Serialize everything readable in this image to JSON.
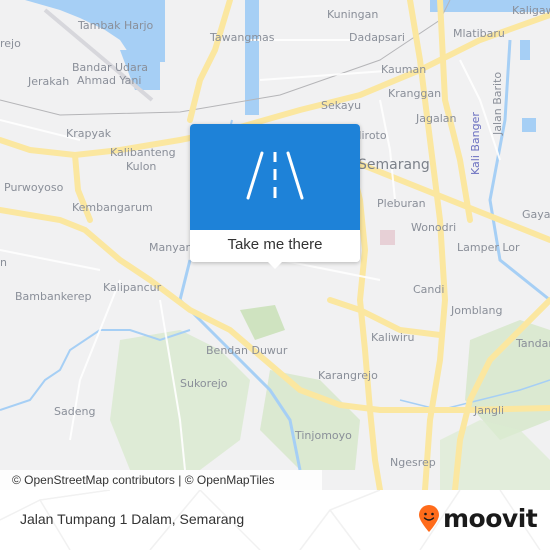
{
  "map": {
    "places": [
      {
        "name": "Tambak Harjo",
        "size": "normal"
      },
      {
        "name": "rejo",
        "size": "normal"
      },
      {
        "name": "Bandar Udara",
        "size": "normal"
      },
      {
        "name": "Ahmad Yani",
        "size": "normal"
      },
      {
        "name": "Jerakah",
        "size": "normal"
      },
      {
        "name": "Krapyak",
        "size": "normal"
      },
      {
        "name": "Kalibanteng",
        "size": "normal"
      },
      {
        "name": "Kulon",
        "size": "normal"
      },
      {
        "name": "Purwoyoso",
        "size": "normal"
      },
      {
        "name": "Kembangarum",
        "size": "normal"
      },
      {
        "name": "Manyar",
        "size": "normal"
      },
      {
        "name": "n",
        "size": "normal"
      },
      {
        "name": "Bambankerep",
        "size": "normal"
      },
      {
        "name": "Kalipancur",
        "size": "normal"
      },
      {
        "name": "Bendan Duwur",
        "size": "normal"
      },
      {
        "name": "Sukorejo",
        "size": "normal"
      },
      {
        "name": "Sadeng",
        "size": "normal"
      },
      {
        "name": "Tinjomoyo",
        "size": "normal"
      },
      {
        "name": "Karangrejo",
        "size": "normal"
      },
      {
        "name": "Ngesrep",
        "size": "normal"
      },
      {
        "name": "Jangli",
        "size": "normal"
      },
      {
        "name": "Tandang",
        "size": "normal"
      },
      {
        "name": "Kaliwiru",
        "size": "normal"
      },
      {
        "name": "Jomblang",
        "size": "normal"
      },
      {
        "name": "Candi",
        "size": "normal"
      },
      {
        "name": "Lamper Lor",
        "size": "normal"
      },
      {
        "name": "Wonodri",
        "size": "normal"
      },
      {
        "name": "Pleburan",
        "size": "normal"
      },
      {
        "name": "Gayam",
        "size": "normal"
      },
      {
        "name": "Semarang",
        "size": "big"
      },
      {
        "name": "Miroto",
        "size": "normal"
      },
      {
        "name": "Jagalan",
        "size": "normal"
      },
      {
        "name": "Kranggan",
        "size": "normal"
      },
      {
        "name": "Kauman",
        "size": "normal"
      },
      {
        "name": "Sekayu",
        "size": "normal"
      },
      {
        "name": "Dadapsari",
        "size": "normal"
      },
      {
        "name": "Kuningan",
        "size": "normal"
      },
      {
        "name": "Tawangmas",
        "size": "normal"
      },
      {
        "name": "Mlatibaru",
        "size": "normal"
      },
      {
        "name": "Kaligawe",
        "size": "normal"
      },
      {
        "name": "Kali Banger",
        "size": "water"
      },
      {
        "name": "Jalan Barito",
        "size": "normal"
      }
    ],
    "attribution": "© OpenStreetMap contributors | © OpenMapTiles"
  },
  "popup": {
    "icon": "road-icon",
    "cta_label": "Take me there",
    "color": "#1e82d8"
  },
  "footer": {
    "address": "Jalan Tumpang 1 Dalam, Semarang",
    "brand": "moovit",
    "brand_color": "#ff6b1a"
  }
}
